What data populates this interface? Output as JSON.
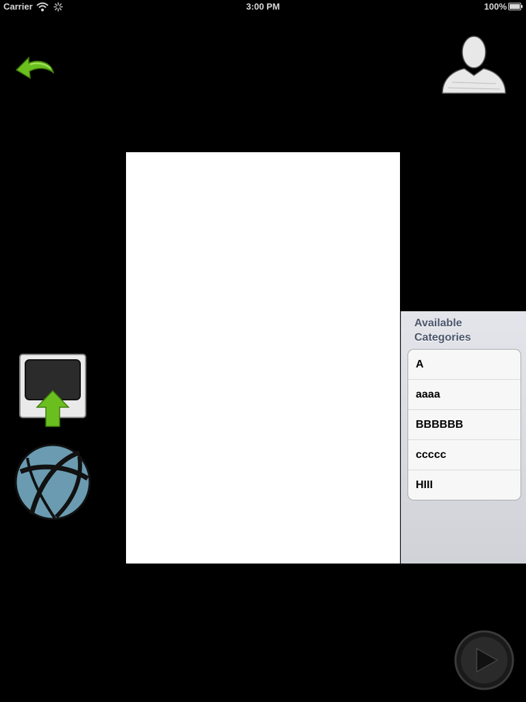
{
  "status_bar": {
    "carrier": "Carrier",
    "time": "3:00 PM",
    "battery": "100%",
    "icons": [
      "wifi-icon",
      "activity-spinner-icon",
      "battery-icon"
    ]
  },
  "toolbar": {
    "undo_icon": "green-undo-arrow-icon",
    "profile_icon": "user-silhouette-icon",
    "upload_icon": "upload-to-screen-icon",
    "globe_icon": "globe-icon",
    "play_icon": "play-icon"
  },
  "categories": {
    "header": "Available\nCategories",
    "items": [
      {
        "label": "A"
      },
      {
        "label": "aaaa"
      },
      {
        "label": "BBBBBB"
      },
      {
        "label": "ccccc"
      },
      {
        "label": "HIII"
      }
    ]
  },
  "colors": {
    "background": "#000000",
    "canvas": "#ffffff",
    "accent_green": "#6abf1e",
    "panel_header_text": "#4c566c"
  }
}
